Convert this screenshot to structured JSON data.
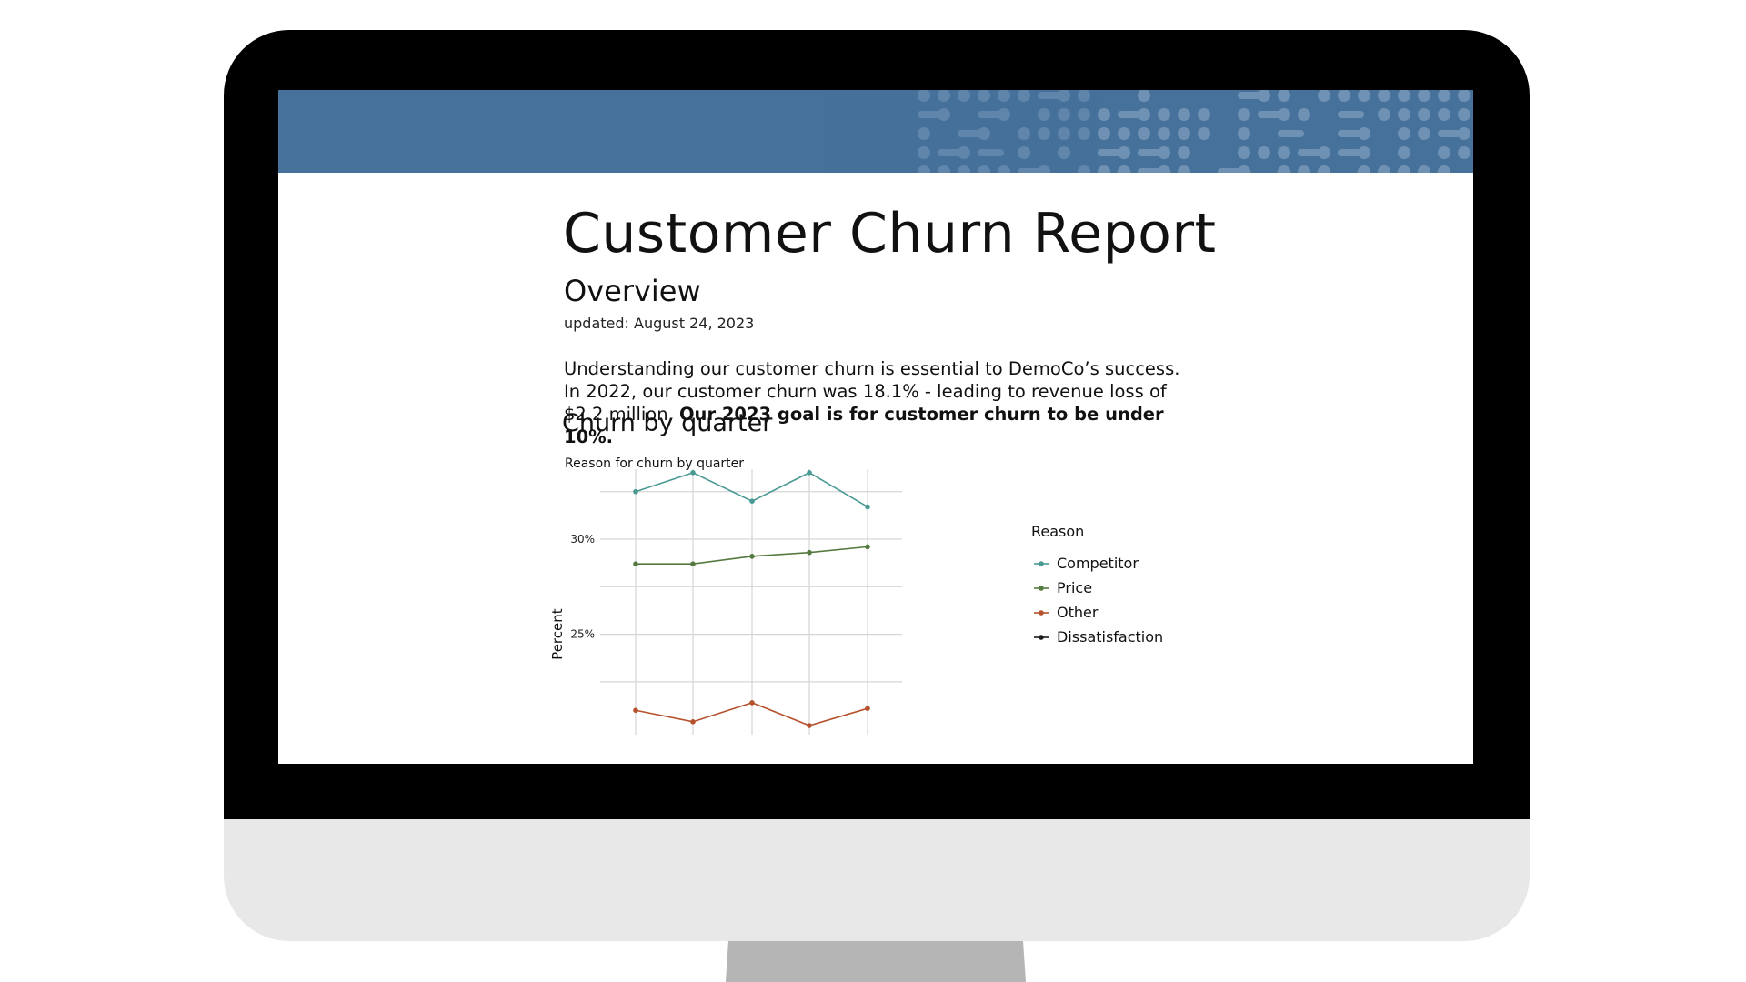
{
  "report": {
    "title": "Customer Churn Report",
    "section_heading": "Overview",
    "updated": "updated: August 24, 2023",
    "intro_plain": "Understanding our customer churn is essential to DemoCo’s success. In 2022, our customer churn was 18.1% - leading to revenue loss of $2.2 million. ",
    "intro_bold": "Our 2023 goal is for customer churn to be under 10%.",
    "chart_heading": "Churn by quarter"
  },
  "colors": {
    "banner": "#45719a",
    "bezel": "#000000",
    "chin": "#e8e8e8",
    "stand": "#b5b5b5"
  },
  "chart_data": {
    "type": "line",
    "title": "Reason for churn by quarter",
    "xlabel": "",
    "ylabel": "Percent",
    "x": [
      1,
      2,
      3,
      4,
      5
    ],
    "y_ticks": [
      {
        "value": 30,
        "label": "30%"
      },
      {
        "value": 25,
        "label": "25%"
      }
    ],
    "ylim": [
      20.2,
      33.3
    ],
    "grid": true,
    "legend_title": "Reason",
    "legend_position": "right",
    "series": [
      {
        "name": "Competitor",
        "color": "#4a9a94",
        "values": [
          32.5,
          33.5,
          32.0,
          33.5,
          31.7
        ]
      },
      {
        "name": "Price",
        "color": "#557a3f",
        "values": [
          28.7,
          28.7,
          29.1,
          29.3,
          29.6
        ]
      },
      {
        "name": "Other",
        "color": "#b5512c",
        "values": [
          21.0,
          20.4,
          21.4,
          20.2,
          21.1
        ]
      },
      {
        "name": "Dissatisfaction",
        "color": "#1a1a1a",
        "values": []
      }
    ]
  }
}
